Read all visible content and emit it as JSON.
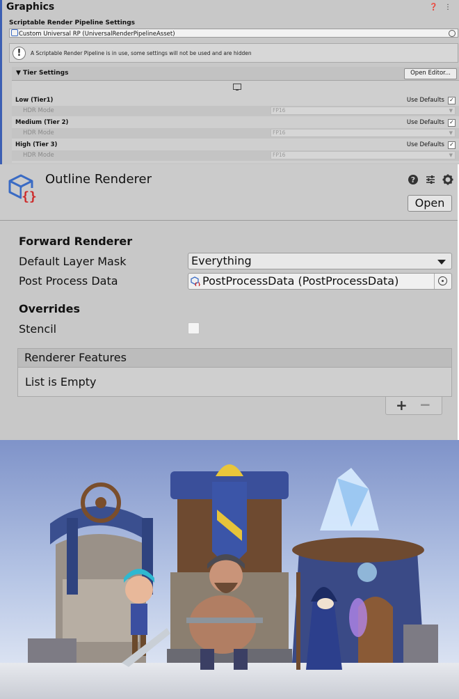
{
  "graphics": {
    "title": "Graphics",
    "header_icons": "❓ ⋮",
    "srp_label": "Scriptable Render Pipeline Settings",
    "srp_value": "Custom Universal RP (UniversalRenderPipelineAsset)",
    "warning": "A Scriptable Render Pipeline is in use, some settings will not be used and are hidden",
    "tier_settings_label": "Tier Settings",
    "open_editor_label": "Open Editor...",
    "tiers": [
      {
        "name": "Low (Tier1)",
        "use_defaults": "Use Defaults",
        "hdr_label": "HDR Mode",
        "hdr_value": "FP16"
      },
      {
        "name": "Medium (Tier 2)",
        "use_defaults": "Use Defaults",
        "hdr_label": "HDR Mode",
        "hdr_value": "FP16"
      },
      {
        "name": "High (Tier 3)",
        "use_defaults": "Use Defaults",
        "hdr_label": "HDR Mode",
        "hdr_value": "FP16"
      }
    ],
    "checkmark": "✓"
  },
  "renderer": {
    "title": "Outline Renderer",
    "open_label": "Open",
    "forward_label": "Forward Renderer",
    "layer_mask_label": "Default Layer Mask",
    "layer_mask_value": "Everything",
    "post_process_label": "Post Process Data",
    "post_process_value": "PostProcessData (PostProcessData)",
    "overrides_label": "Overrides",
    "stencil_label": "Stencil",
    "stencil_checked": false,
    "features_label": "Renderer Features",
    "features_empty": "List is Empty",
    "add_label": "+",
    "remove_label": "−"
  },
  "colors": {
    "accent_blue": "#3a6bc4",
    "icon_red": "#cc2a2a"
  }
}
